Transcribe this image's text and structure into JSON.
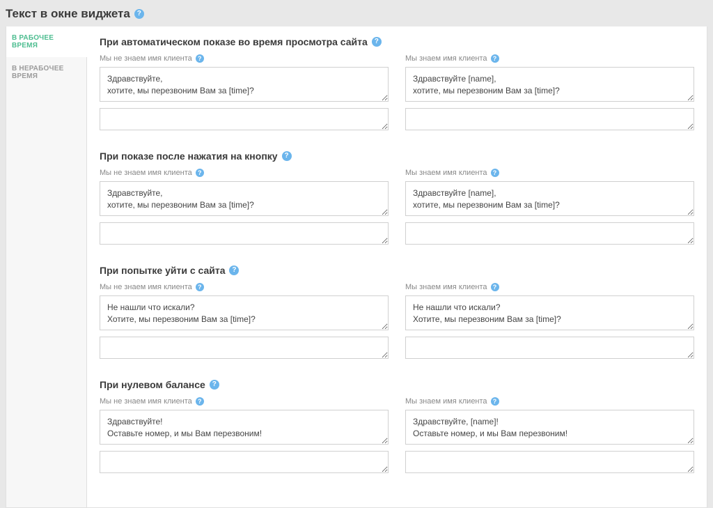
{
  "section_title": "Текст в окне виджета",
  "tabs": {
    "work": "В РАБОЧЕЕ ВРЕМЯ",
    "nonwork": "В НЕРАБОЧЕЕ ВРЕМЯ"
  },
  "labels": {
    "name_unknown": "Мы не знаем имя клиента",
    "name_known": "Мы знаем имя клиента"
  },
  "groups": {
    "auto_view": {
      "title": "При автоматическом показе во время просмотра сайта",
      "unknown_main": "Здравствуйте,\nхотите, мы перезвоним Вам за [time]?",
      "unknown_sub": "",
      "known_main": "Здравствуйте [name],\nхотите, мы перезвоним Вам за [time]?",
      "known_sub": ""
    },
    "after_click": {
      "title": "При показе после нажатия на кнопку",
      "unknown_main": "Здравствуйте,\nхотите, мы перезвоним Вам за [time]?",
      "unknown_sub": "",
      "known_main": "Здравствуйте [name],\nхотите, мы перезвоним Вам за [time]?",
      "known_sub": ""
    },
    "exit_intent": {
      "title": "При попытке уйти с сайта",
      "unknown_main": "Не нашли что искали?\nХотите, мы перезвоним Вам за [time]?",
      "unknown_sub": "",
      "known_main": "Не нашли что искали?\nХотите, мы перезвоним Вам за [time]?",
      "known_sub": ""
    },
    "zero_balance": {
      "title": "При нулевом балансе",
      "unknown_main": "Здравствуйте!\nОставьте номер, и мы Вам перезвоним!",
      "unknown_sub": "",
      "known_main": "Здравствуйте, [name]!\nОставьте номер, и мы Вам перезвоним!",
      "known_sub": ""
    }
  }
}
